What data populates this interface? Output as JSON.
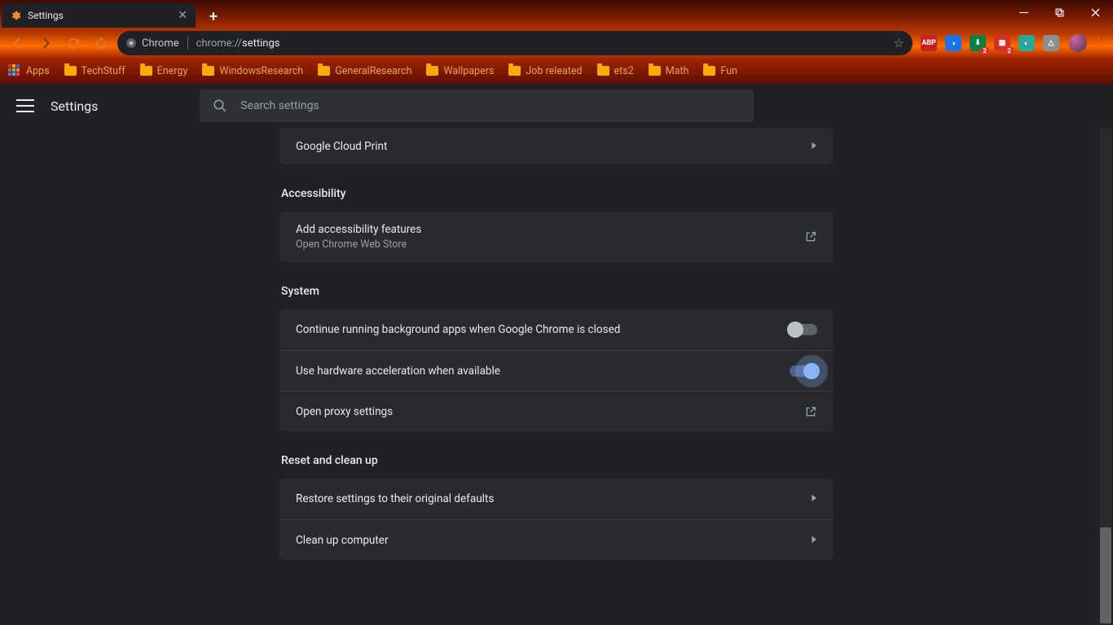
{
  "tab": {
    "title": "Settings"
  },
  "omnibox": {
    "chip": "Chrome",
    "path_muted": "chrome://",
    "path_bold": "settings"
  },
  "bookmarks": {
    "apps": "Apps",
    "items": [
      "TechStuff",
      "Energy",
      "WindowsResearch",
      "GeneralResearch",
      "Wallpapers",
      "Job releated",
      "ets2",
      "Math",
      "Fun"
    ]
  },
  "header": {
    "title": "Settings",
    "search_placeholder": "Search settings"
  },
  "printing": {
    "row": "Google Cloud Print"
  },
  "accessibility": {
    "title": "Accessibility",
    "row_title": "Add accessibility features",
    "row_sub": "Open Chrome Web Store"
  },
  "system": {
    "title": "System",
    "bg_apps": "Continue running background apps when Google Chrome is closed",
    "hw_accel": "Use hardware acceleration when available",
    "proxy": "Open proxy settings"
  },
  "reset": {
    "title": "Reset and clean up",
    "restore": "Restore settings to their original defaults",
    "cleanup": "Clean up computer"
  },
  "colors": {
    "accent": "#8ab4f8"
  }
}
